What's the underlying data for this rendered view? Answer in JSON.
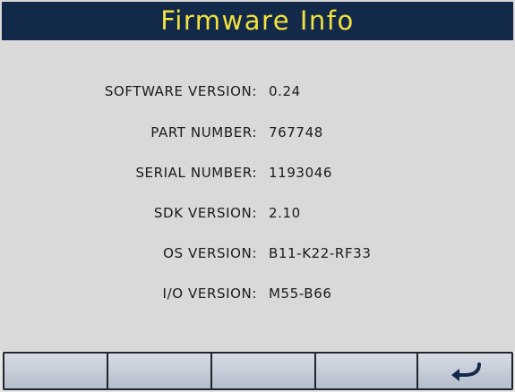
{
  "header": {
    "title": "Firmware Info"
  },
  "firmware": {
    "rows": [
      {
        "label": "SOFTWARE VERSION:",
        "value": "0.24"
      },
      {
        "label": "PART NUMBER:",
        "value": "767748"
      },
      {
        "label": "SERIAL NUMBER:",
        "value": "1193046"
      },
      {
        "label": "SDK VERSION:",
        "value": "2.10"
      },
      {
        "label": "OS VERSION:",
        "value": "B11-K22-RF33"
      },
      {
        "label": "I/O VERSION:",
        "value": "M55-B66"
      }
    ]
  },
  "softkeys": {
    "back_icon": "back-arrow-icon"
  },
  "colors": {
    "title_bg": "#13294a",
    "title_text": "#f2e23d",
    "screen_bg": "#d9d9d9"
  }
}
